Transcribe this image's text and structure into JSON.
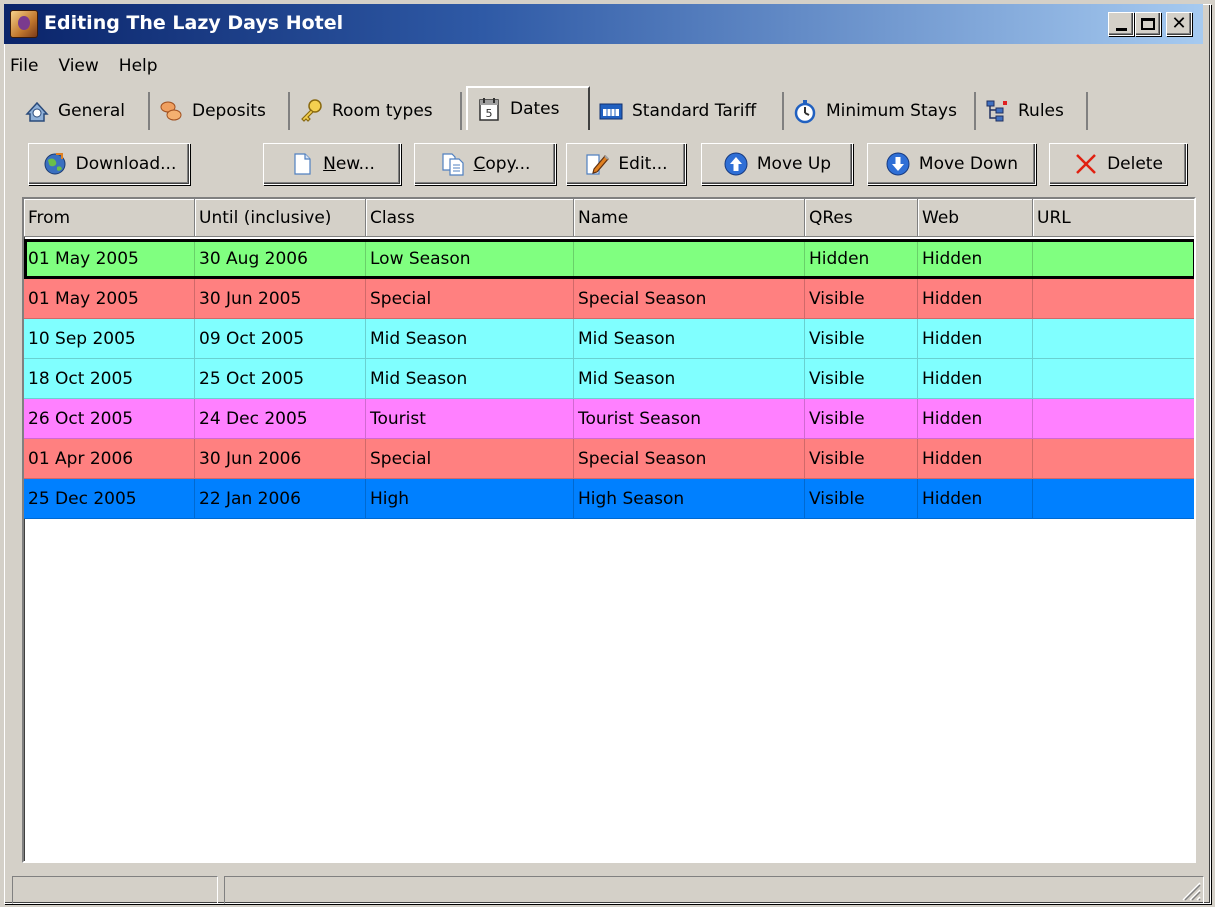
{
  "window": {
    "title": "Editing The Lazy Days Hotel",
    "controls": [
      "minimize",
      "maximize",
      "close"
    ]
  },
  "menu": [
    "File",
    "View",
    "Help"
  ],
  "tabs": [
    {
      "label": "General",
      "icon": "general-icon"
    },
    {
      "label": "Deposits",
      "icon": "deposits-icon"
    },
    {
      "label": "Room types",
      "icon": "key-icon"
    },
    {
      "label": "Dates",
      "icon": "calendar-icon",
      "active": true
    },
    {
      "label": "Standard Tariff",
      "icon": "tariff-icon"
    },
    {
      "label": "Minimum Stays",
      "icon": "stopwatch-icon"
    },
    {
      "label": "Rules",
      "icon": "rules-icon"
    }
  ],
  "toolbar": {
    "download": "Download...",
    "new_underline": "N",
    "new_rest": "ew...",
    "copy_underline": "C",
    "copy_rest": "opy...",
    "edit": "Edit...",
    "move_up": "Move Up",
    "move_down": "Move Down",
    "delete": "Delete"
  },
  "grid": {
    "columns": [
      "From",
      "Until (inclusive)",
      "Class",
      "Name",
      "QRes",
      "Web",
      "URL"
    ],
    "rows": [
      {
        "from": "01 May 2005",
        "until": "30 Aug 2006",
        "class": "Low Season",
        "name": "",
        "qres": "Hidden",
        "web": "Hidden",
        "url": "",
        "color": "#80ff80"
      },
      {
        "from": "01 May 2005",
        "until": "30 Jun 2005",
        "class": "Special",
        "name": "Special Season",
        "qres": "Visible",
        "web": "Hidden",
        "url": "",
        "color": "#ff8080"
      },
      {
        "from": "10 Sep 2005",
        "until": "09 Oct 2005",
        "class": "Mid Season",
        "name": "Mid Season",
        "qres": "Visible",
        "web": "Hidden",
        "url": "",
        "color": "#80ffff"
      },
      {
        "from": "18 Oct 2005",
        "until": "25 Oct 2005",
        "class": "Mid Season",
        "name": "Mid Season",
        "qres": "Visible",
        "web": "Hidden",
        "url": "",
        "color": "#80ffff"
      },
      {
        "from": "26 Oct 2005",
        "until": "24 Dec 2005",
        "class": "Tourist",
        "name": "Tourist Season",
        "qres": "Visible",
        "web": "Hidden",
        "url": "",
        "color": "#ff80ff"
      },
      {
        "from": "01 Apr 2006",
        "until": "30 Jun 2006",
        "class": "Special",
        "name": "Special Season",
        "qres": "Visible",
        "web": "Hidden",
        "url": "",
        "color": "#ff8080"
      },
      {
        "from": "25 Dec 2005",
        "until": "22 Jan 2006",
        "class": "High",
        "name": "High Season",
        "qres": "Visible",
        "web": "Hidden",
        "url": "",
        "color": "#0080ff"
      }
    ]
  },
  "status": {
    "panel1": "",
    "panel2": ""
  }
}
